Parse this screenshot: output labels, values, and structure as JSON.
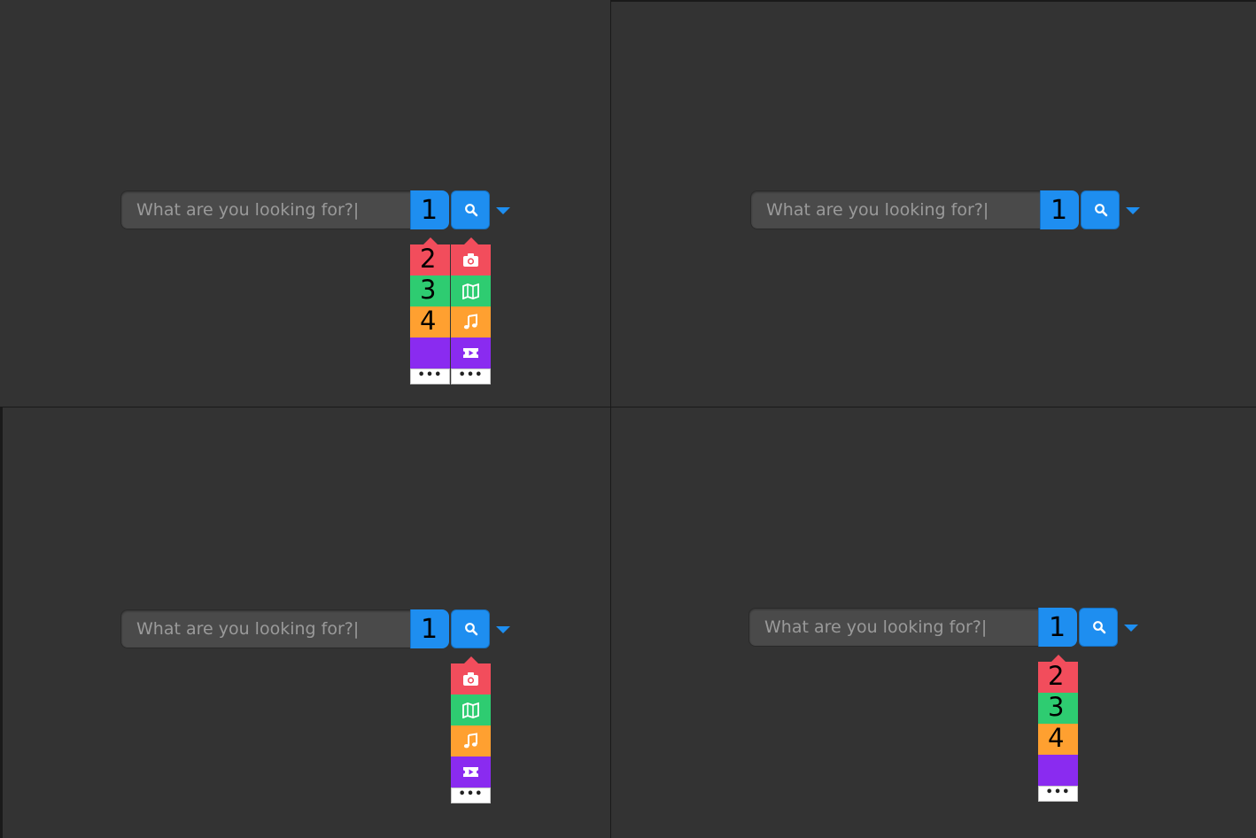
{
  "placeholder": "What are you looking for?",
  "caret": "|",
  "labels": {
    "n1": "1",
    "n2": "2",
    "n3": "3",
    "n4": "4"
  },
  "more_label": "•••",
  "colors": {
    "background": "#333333",
    "blue": "#1e8ef0",
    "red": "#f24d5c",
    "green": "#2ecc71",
    "orange": "#ffa030",
    "purple": "#8a2bf0"
  },
  "category_icons": [
    "camera-icon",
    "map-icon",
    "music-icon",
    "ticket-icon",
    "more-icon"
  ]
}
